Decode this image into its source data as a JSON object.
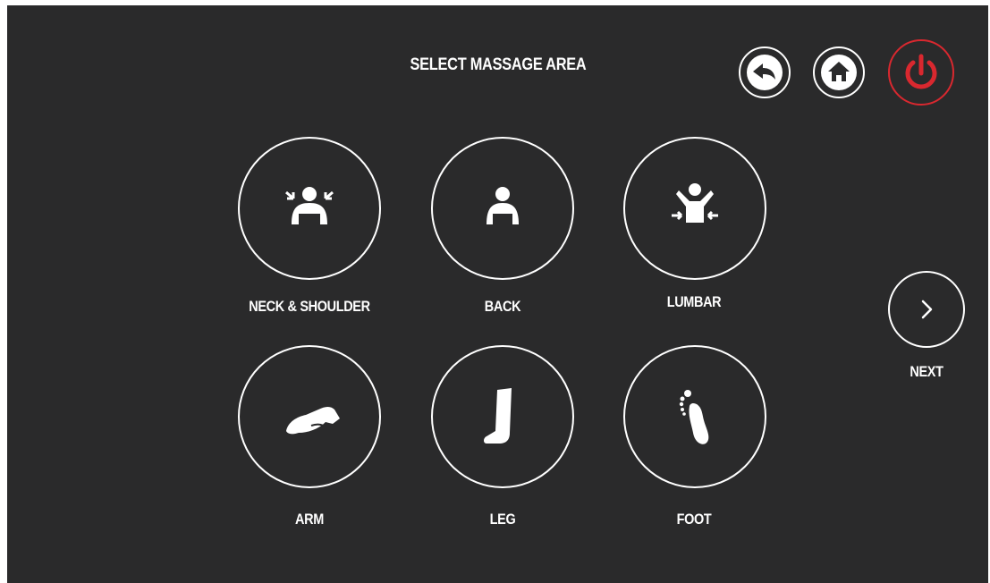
{
  "header": {
    "title": "SELECT MASSAGE AREA"
  },
  "controls": {
    "back_icon": "back-arrow-icon",
    "home_icon": "home-icon",
    "power_icon": "power-icon",
    "power_color": "#d9282f"
  },
  "areas": [
    {
      "label": "NECK & SHOULDER",
      "icon": "neck-shoulder-icon"
    },
    {
      "label": "BACK",
      "icon": "back-body-icon"
    },
    {
      "label": "LUMBAR",
      "icon": "lumbar-icon"
    },
    {
      "label": "ARM",
      "icon": "arm-icon"
    },
    {
      "label": "LEG",
      "icon": "leg-icon"
    },
    {
      "label": "FOOT",
      "icon": "foot-icon"
    }
  ],
  "next": {
    "label": "NEXT",
    "icon": "chevron-right-icon"
  },
  "colors": {
    "background": "#2a2a2b",
    "foreground": "#ffffff",
    "accent": "#d9282f"
  }
}
